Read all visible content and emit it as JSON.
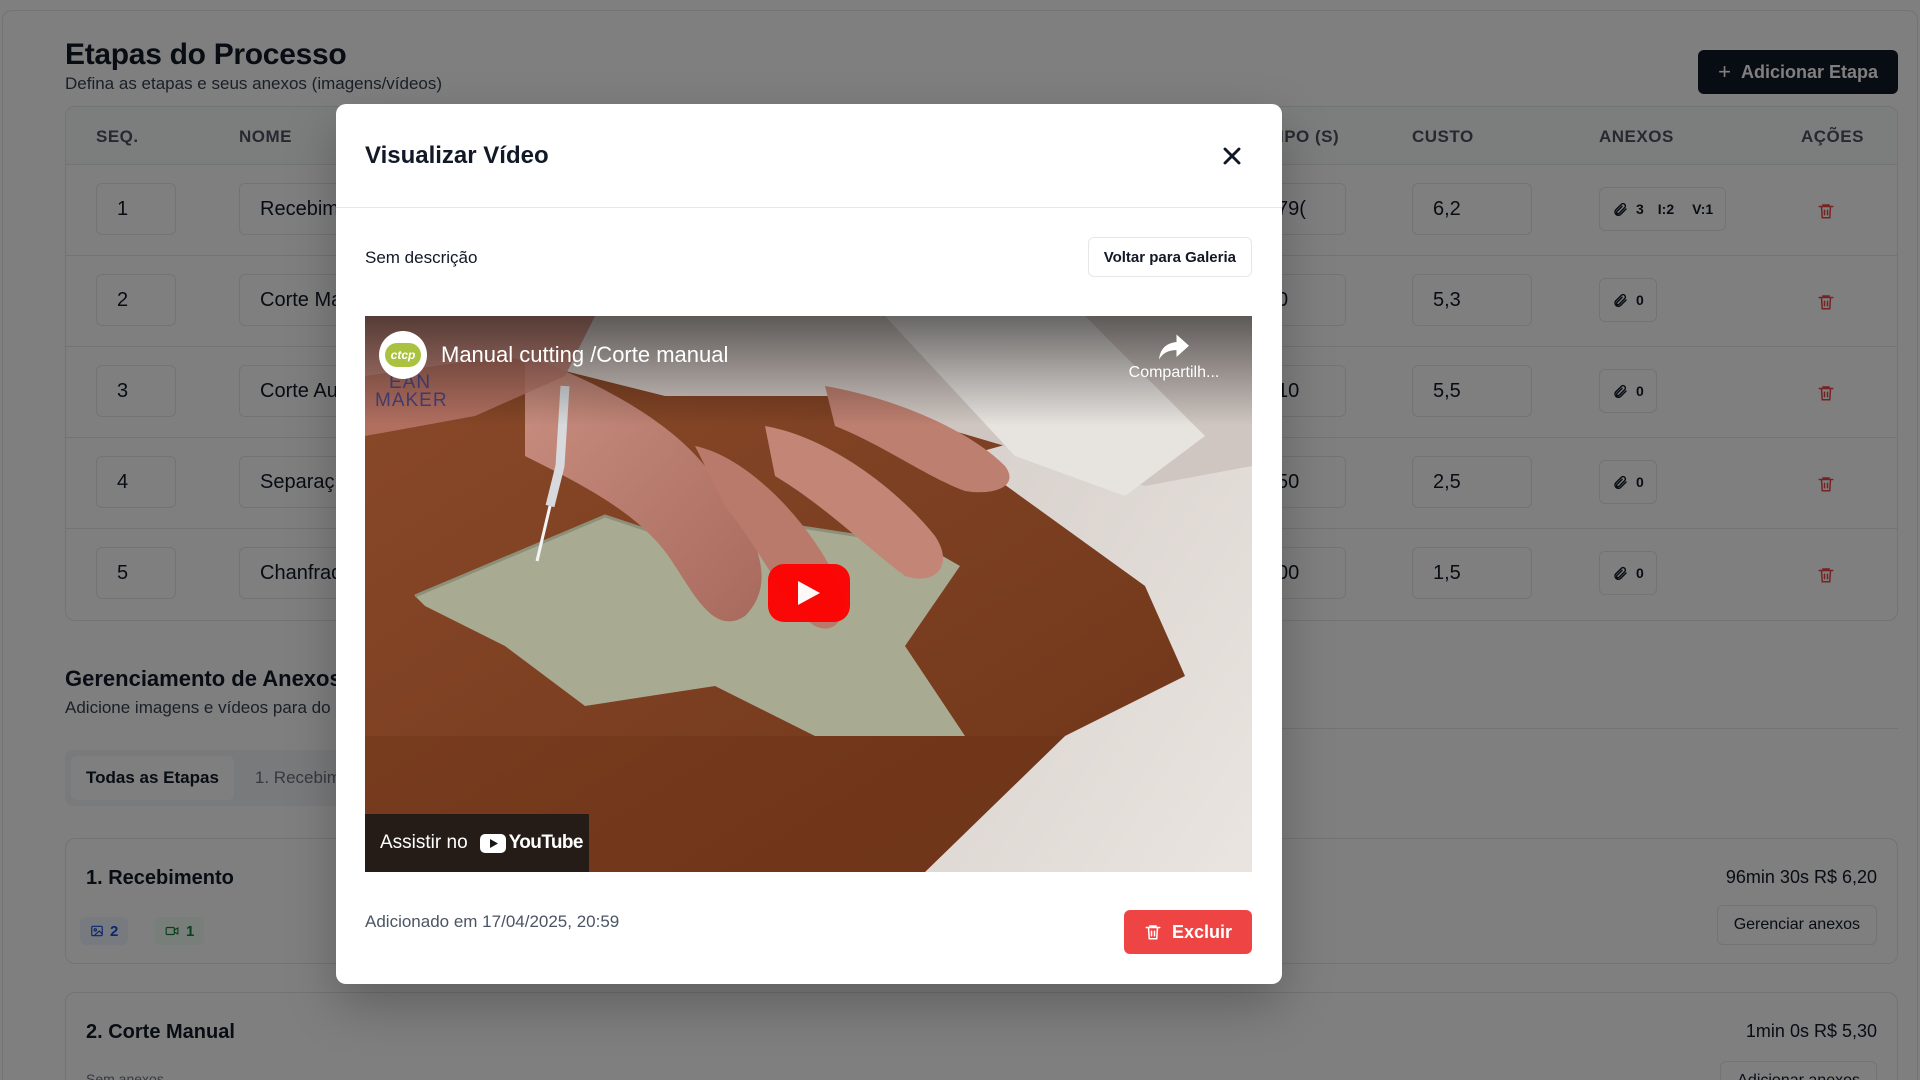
{
  "page": {
    "title": "Etapas do Processo",
    "subtitle": "Defina as etapas e seus anexos (imagens/vídeos)",
    "add_step_label": "Adicionar Etapa"
  },
  "table": {
    "headers": {
      "seq": "SEQ.",
      "nome": "NOME",
      "tempo": "IPO (S)",
      "custo": "CUSTO",
      "anexos": "ANEXOS",
      "acoes": "AÇÕES"
    },
    "rows": [
      {
        "seq": "1",
        "nome": "Recebim",
        "tempo": "79(",
        "custo": "6,2",
        "anexos": "3",
        "imagens": "I:2",
        "videos": "V:1"
      },
      {
        "seq": "2",
        "nome": "Corte Ma",
        "tempo": "0",
        "custo": "5,3",
        "anexos": "0"
      },
      {
        "seq": "3",
        "nome": "Corte Au",
        "tempo": "10",
        "custo": "5,5",
        "anexos": "0"
      },
      {
        "seq": "4",
        "nome": "Separaç",
        "tempo": "50",
        "custo": "2,5",
        "anexos": "0"
      },
      {
        "seq": "5",
        "nome": "Chanfrad",
        "tempo": "00",
        "custo": "1,5",
        "anexos": "0"
      }
    ]
  },
  "attachments": {
    "title": "Gerenciamento de Anexos",
    "subtitle": "Adicione imagens e vídeos para do",
    "tabs": [
      "Todas as Etapas",
      "1. Recebim"
    ],
    "cards": [
      {
        "title": "1. Recebimento",
        "meta": "96min 30s  R$ 6,20",
        "images": "2",
        "videos": "1",
        "button": "Gerenciar anexos"
      },
      {
        "title": "2. Corte Manual",
        "meta": "1min 0s  R$ 5,30",
        "note": "Sem anexos",
        "button": "Adicionar anexos"
      }
    ]
  },
  "modal": {
    "title": "Visualizar Vídeo",
    "description": "Sem descrição",
    "back_label": "Voltar para Galeria",
    "video": {
      "title": "Manual cutting /Corte manual",
      "channel": "ctcp",
      "watermark_line1": "EAN",
      "watermark_line2": "MAKER",
      "share_label": "Compartilh...",
      "watch_on": "Assistir no",
      "youtube_label": "YouTube"
    },
    "added_at": "Adicionado em 17/04/2025, 20:59",
    "delete_label": "Excluir"
  },
  "colors": {
    "primary": "#111827",
    "danger": "#ef4444",
    "youtube_red": "#ff0000",
    "channel_green": "#a9c23f"
  }
}
